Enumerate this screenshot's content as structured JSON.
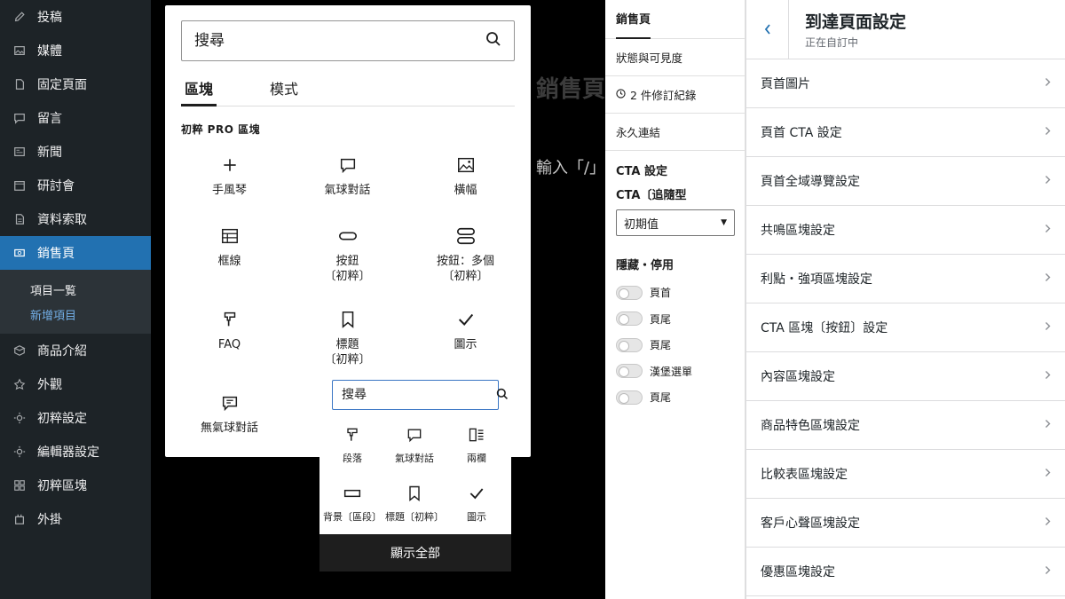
{
  "admin_menu": {
    "items_top": [
      {
        "label": "投稿",
        "icon": "pencil-icon"
      },
      {
        "label": "媒體",
        "icon": "media-icon"
      },
      {
        "label": "固定頁面",
        "icon": "page-icon"
      },
      {
        "label": "留言",
        "icon": "comment-icon"
      },
      {
        "label": "新聞",
        "icon": "news-icon"
      },
      {
        "label": "研討會",
        "icon": "calendar-icon"
      },
      {
        "label": "資料索取",
        "icon": "document-icon"
      },
      {
        "label": "銷售頁",
        "icon": "salespage-icon"
      }
    ],
    "submenu": [
      "項目一覧",
      "新增項目"
    ],
    "items_bottom": [
      {
        "label": "商品介紹",
        "icon": "box-icon"
      },
      {
        "label": "外觀",
        "icon": "appearance-icon"
      },
      {
        "label": "初粹設定",
        "icon": "gear-icon"
      },
      {
        "label": "編輯器設定",
        "icon": "gear-icon"
      },
      {
        "label": "初粹區塊",
        "icon": "blocks-icon"
      },
      {
        "label": "外掛",
        "icon": "plugin-icon"
      }
    ]
  },
  "editor": {
    "title": "銷售頁",
    "hint": "輸入「/」"
  },
  "inserter": {
    "search_placeholder": "搜尋",
    "tabs": [
      "區塊",
      "模式"
    ],
    "category": "初粹 PRO 區塊",
    "blocks": [
      {
        "label": "手風琴",
        "icon": "plus-icon"
      },
      {
        "label": "氣球對話",
        "icon": "speech-bubble-icon"
      },
      {
        "label": "橫幅",
        "icon": "image-icon"
      },
      {
        "label": "框線",
        "icon": "table-icon"
      },
      {
        "label": "按鈕\n〔初粹〕",
        "icon": "button-icon"
      },
      {
        "label": "按鈕：多個\n〔初粹〕",
        "icon": "buttons-icon"
      },
      {
        "label": "FAQ",
        "icon": "paragraph-icon"
      },
      {
        "label": "標題\n〔初粹〕",
        "icon": "bookmark-icon"
      },
      {
        "label": "圖示",
        "icon": "check-icon"
      },
      {
        "label": "無氣球對話",
        "icon": "dialog-icon"
      }
    ]
  },
  "quick_inserter": {
    "search_placeholder": "搜尋",
    "blocks": [
      {
        "label": "段落",
        "icon": "paragraph-icon"
      },
      {
        "label": "氣球對話",
        "icon": "speech-bubble-icon"
      },
      {
        "label": "兩欄",
        "icon": "columns-icon"
      },
      {
        "label": "背景〔區段〕",
        "icon": "background-icon"
      },
      {
        "label": "標題〔初粹〕",
        "icon": "bookmark-icon"
      },
      {
        "label": "圖示",
        "icon": "check-icon"
      }
    ],
    "show_all": "顯示全部"
  },
  "settings": {
    "tab": "銷售頁",
    "rows": [
      "狀態與可見度",
      "2 件修訂紀錄",
      "永久連結"
    ],
    "cta_heading": "CTA 設定",
    "cta_sub": "CTA〔追隨型",
    "cta_select": "初期值",
    "hide_heading": "隱藏・停用",
    "toggles": [
      "頁首",
      "頁尾",
      "頁尾",
      "漢堡選單",
      "頁尾"
    ]
  },
  "customizer": {
    "title": "到達頁面設定",
    "subtitle": "正在自訂中",
    "items": [
      "頁首圖片",
      "頁首 CTA 設定",
      "頁首全域導覽設定",
      "共鳴區塊設定",
      "利點・強項區塊設定",
      "CTA 區塊〔按鈕〕設定",
      "內容區塊設定",
      "商品特色區塊設定",
      "比較表區塊設定",
      "客戶心聲區塊設定",
      "優惠區塊設定"
    ]
  },
  "colors": {
    "admin_bg": "#1d2327",
    "admin_active": "#2271b1",
    "submenu_current": "#72aee6",
    "focus_blue": "#3a76c4"
  }
}
